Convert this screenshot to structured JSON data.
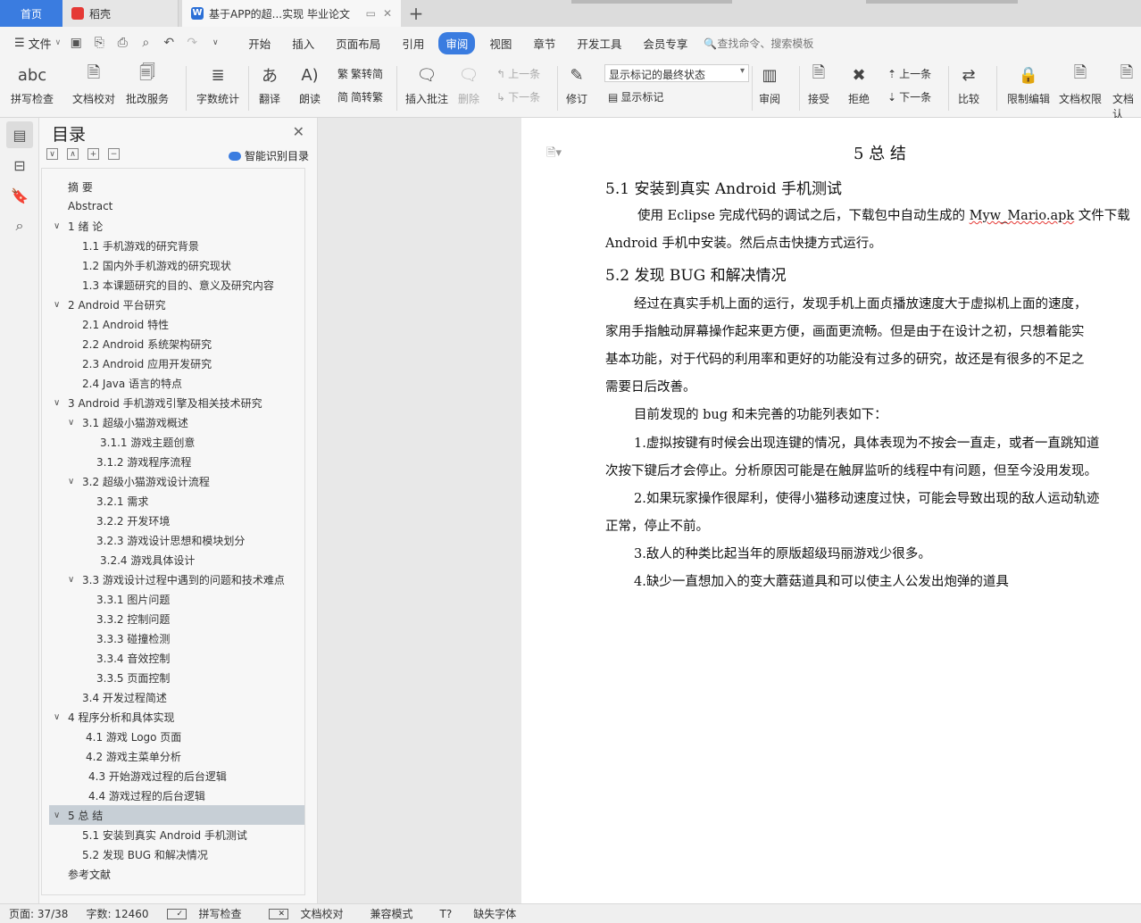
{
  "tabs": {
    "home": "首页",
    "doc1": "稻壳",
    "doc2": "基于APP的超...实现 毕业论文"
  },
  "menu": {
    "file": "文件",
    "items": [
      "开始",
      "插入",
      "页面布局",
      "引用",
      "审阅",
      "视图",
      "章节",
      "开发工具",
      "会员专享"
    ],
    "search": "查找命令、搜索模板"
  },
  "ribbon": {
    "spell": "拼写检查",
    "doc_proof": "文档校对",
    "batch": "批改服务",
    "word_count": "字数统计",
    "translate": "翻译",
    "read": "朗读",
    "trad": "繁转简",
    "simp": "简转繁",
    "insert_comment": "插入批注",
    "delete": "删除",
    "prev_comment": "上一条",
    "next_comment": "下一条",
    "track": "修订",
    "markup_state": "显示标记的最终状态",
    "show_markup": "显示标记",
    "review": "审阅",
    "accept": "接受",
    "reject": "拒绝",
    "prev": "上一条",
    "next": "下一条",
    "compare": "比较",
    "restrict": "限制编辑",
    "doc_perm": "文档权限",
    "doc_cert": "文档认"
  },
  "toc": {
    "title": "目录",
    "smart": "智能识别目录",
    "items": [
      "摘  要",
      "Abstract",
      "1 绪  论",
      "1.1 手机游戏的研究背景",
      "1.2 国内外手机游戏的研究现状",
      "1.3 本课题研究的目的、意义及研究内容",
      "2 Android 平台研究",
      "2.1 Android 特性",
      "2.2 Android 系统架构研究",
      "2.3 Android 应用开发研究",
      "2.4 Java 语言的特点",
      "3 Android 手机游戏引擎及相关技术研究",
      "3.1 超级小猫游戏概述",
      "3.1.1 游戏主题创意",
      "3.1.2 游戏程序流程",
      "3.2 超级小猫游戏设计流程",
      "3.2.1 需求",
      "3.2.2 开发环境",
      "3.2.3 游戏设计思想和模块划分",
      "3.2.4 游戏具体设计",
      "3.3 游戏设计过程中遇到的问题和技术难点",
      "3.3.1 图片问题",
      "3.3.2 控制问题",
      "3.3.3 碰撞检测",
      "3.3.4 音效控制",
      "3.3.5 页面控制",
      "3.4 开发过程简述",
      "4 程序分析和具体实现",
      "4.1 游戏 Logo 页面",
      "4.2 游戏主菜单分析",
      "4.3 开始游戏过程的后台逻辑",
      "4.4 游戏过程的后台逻辑",
      "5 总  结",
      "5.1 安装到真实 Android 手机测试",
      "5.2 发现 BUG 和解决情况",
      "参考文献"
    ]
  },
  "doc": {
    "h1": "5 总  结",
    "h2a": "5.1 安装到真实 Android 手机测试",
    "p1a": "使用 Eclipse 完成代码的调试之后，下载包中自动生成的 ",
    "p1u": "Myw_Mario.apk",
    "p1b": " 文件下载",
    "p2": "Android 手机中安装。然后点击快捷方式运行。",
    "h2b": "5.2 发现 BUG 和解决情况",
    "p3": "经过在真实手机上面的运行，发现手机上面贞播放速度大于虚拟机上面的速度，",
    "p4": "家用手指触动屏幕操作起来更方便，画面更流畅。但是由于在设计之初，只想着能实",
    "p5": "基本功能，对于代码的利用率和更好的功能没有过多的研究，故还是有很多的不足之",
    "p6": "需要日后改善。",
    "p7": "目前发现的 bug 和未完善的功能列表如下：",
    "p8": "1.虚拟按键有时候会出现连键的情况，具体表现为不按会一直走，或者一直跳知道",
    "p9": "次按下键后才会停止。分析原因可能是在触屏监听的线程中有问题，但至今没用发现。",
    "p10": "2.如果玩家操作很犀利，使得小猫移动速度过快，可能会导致出现的敌人运动轨迹",
    "p11": "正常，停止不前。",
    "p12": "3.敌人的种类比起当年的原版超级玛丽游戏少很多。",
    "p13": "4.缺少一直想加入的变大蘑菇道具和可以使主人公发出炮弹的道具"
  },
  "status": {
    "page": "页面: 37/38",
    "words": "字数: 12460",
    "spell": "拼写检查",
    "proof": "文档校对",
    "compat": "兼容模式",
    "missing_font": "缺失字体"
  }
}
